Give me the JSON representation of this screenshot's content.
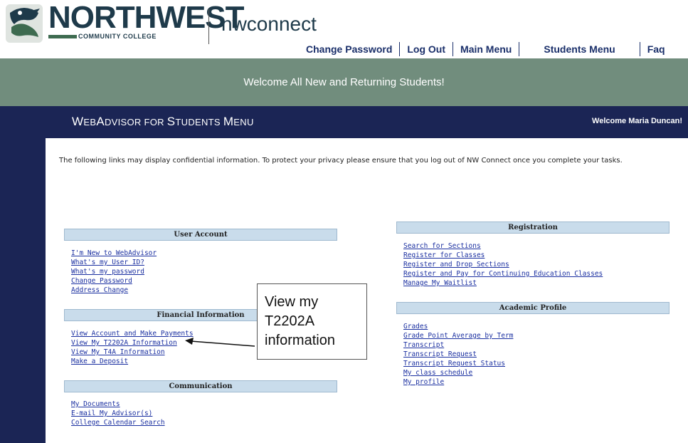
{
  "header": {
    "logo_main": "NORTHWEST",
    "logo_sub": "COMMUNITY COLLEGE",
    "app_name": "nwconnect",
    "logo_icon": "raven-crest-icon"
  },
  "topnav": {
    "items": [
      "Change Password",
      "Log Out",
      "Main Menu",
      "Students Menu",
      "Faq"
    ]
  },
  "welcome_banner": "Welcome All New and Returning Students!",
  "menu": {
    "title_w": "W",
    "title_w_rest": "EB",
    "title_a": "A",
    "title_a_rest": "DVISOR FOR ",
    "title_s": "S",
    "title_s_rest": "TUDENTS ",
    "title_m": "M",
    "title_m_rest": "ENU",
    "welcome_user": "Welcome Maria Duncan!"
  },
  "notice": "The following links may display confidential information. To protect your privacy please ensure that you log out of NW Connect once you complete your tasks.",
  "sections": {
    "user_account": {
      "title": "User Account",
      "links": [
        "I'm New to WebAdvisor",
        "What's my User ID?",
        "What's my password",
        "Change Password",
        "Address Change"
      ]
    },
    "financial": {
      "title": "Financial Information",
      "links": [
        "View Account and Make Payments",
        "View My T2202A Information",
        "View My T4A Information",
        "Make a Deposit"
      ]
    },
    "communication": {
      "title": "Communication",
      "links": [
        "My Documents",
        "E-mail My Advisor(s)",
        "College Calendar Search"
      ]
    },
    "registration": {
      "title": "Registration",
      "links": [
        "Search for Sections",
        "Register for Classes",
        "Register and Drop Sections",
        "Register and Pay for Continuing Education Classes",
        "Manage My Waitlist"
      ]
    },
    "academic": {
      "title": "Academic Profile",
      "links": [
        "Grades",
        "Grade Point Average by Term",
        "Transcript",
        "Transcript Request",
        "Transcript Request Status",
        "My class schedule",
        "My profile"
      ]
    }
  },
  "callout": {
    "line1": "View my",
    "line2": "T2202A",
    "line3": "information"
  },
  "colors": {
    "banner": "#718d7d",
    "frame": "#1b2555",
    "section_header": "#c9dceb",
    "link": "#1a2fa0"
  }
}
